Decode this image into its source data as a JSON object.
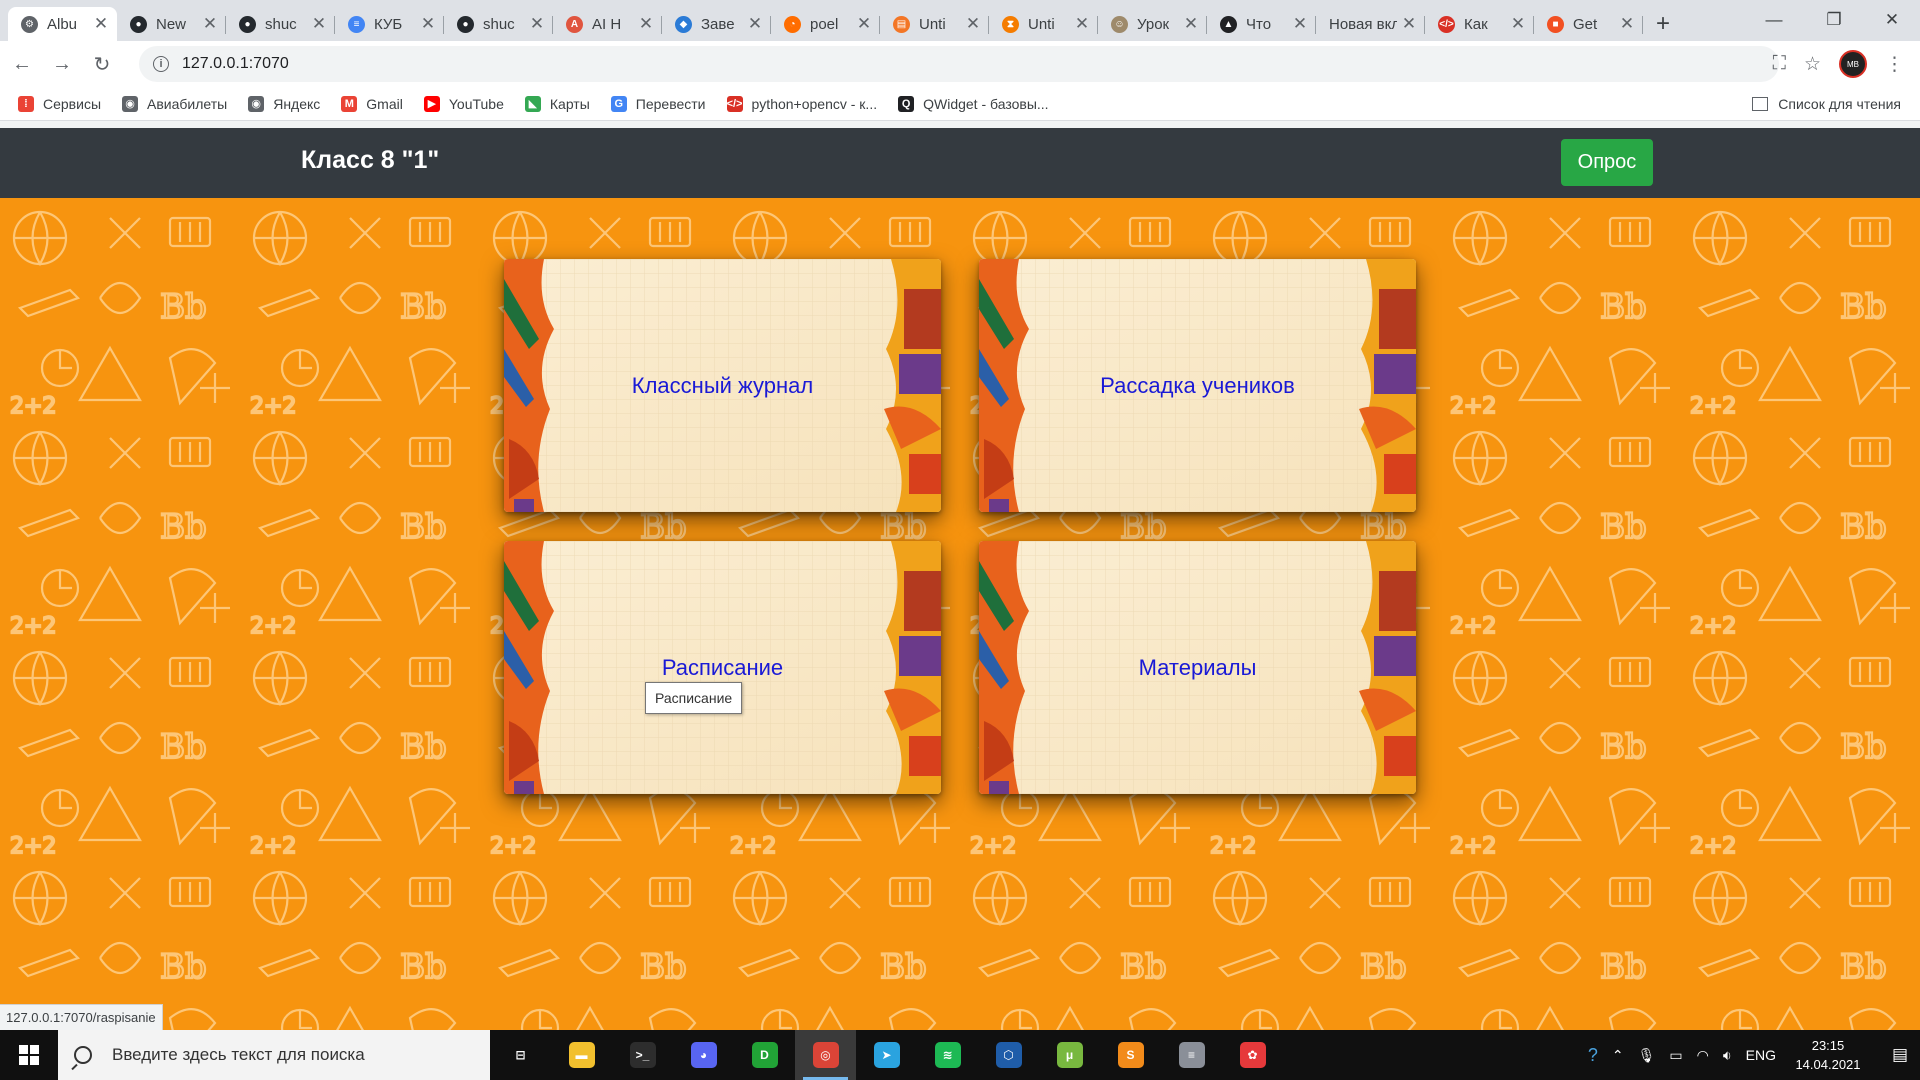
{
  "browser": {
    "tabs": [
      {
        "label": "Albu",
        "icon": "chrome-tab-icon",
        "color": "#5f6368",
        "glyph": "⚙",
        "active": true
      },
      {
        "label": "New",
        "icon": "github-icon",
        "color": "#24292e",
        "glyph": "●"
      },
      {
        "label": "shuc",
        "icon": "github-icon",
        "color": "#24292e",
        "glyph": "●"
      },
      {
        "label": "КУБ",
        "icon": "docs-icon",
        "color": "#4285f4",
        "glyph": "≡"
      },
      {
        "label": "shuc",
        "icon": "github-icon",
        "color": "#24292e",
        "glyph": "●"
      },
      {
        "label": "AI H",
        "icon": "ai-icon",
        "color": "#e0553f",
        "glyph": "A"
      },
      {
        "label": "Заве",
        "icon": "game-icon",
        "color": "#2b7bd6",
        "glyph": "◆"
      },
      {
        "label": "poel",
        "icon": "loading-icon",
        "color": "#ff6d00",
        "glyph": "◔"
      },
      {
        "label": "Unti",
        "icon": "notebook-icon",
        "color": "#f37626",
        "glyph": "▤"
      },
      {
        "label": "Unti",
        "icon": "hourglass-icon",
        "color": "#f57c00",
        "glyph": "⧗"
      },
      {
        "label": "Урок",
        "icon": "avatar-icon",
        "color": "#9e8a6b",
        "glyph": "☺"
      },
      {
        "label": "Что",
        "icon": "triangle-icon",
        "color": "#202124",
        "glyph": "▲"
      },
      {
        "label": "Новая вкл",
        "icon": "",
        "color": "",
        "glyph": ""
      },
      {
        "label": "Как",
        "icon": "code-icon",
        "color": "#d93025",
        "glyph": "</>"
      },
      {
        "label": "Get",
        "icon": "windows-logo-icon",
        "color": "#f25022",
        "glyph": "■"
      }
    ],
    "url": "127.0.0.1:7070",
    "bookmarks": [
      {
        "label": "Сервисы",
        "icon": "apps-grid-icon",
        "color": "#ea4335",
        "glyph": "⁞"
      },
      {
        "label": "Авиабилеты",
        "icon": "globe-icon",
        "color": "#5f6368",
        "glyph": "◉"
      },
      {
        "label": "Яндекс",
        "icon": "globe-icon",
        "color": "#5f6368",
        "glyph": "◉"
      },
      {
        "label": "Gmail",
        "icon": "gmail-icon",
        "color": "#ea4335",
        "glyph": "M"
      },
      {
        "label": "YouTube",
        "icon": "youtube-icon",
        "color": "#ff0000",
        "glyph": "▶"
      },
      {
        "label": "Карты",
        "icon": "maps-icon",
        "color": "#34a853",
        "glyph": "◣"
      },
      {
        "label": "Перевести",
        "icon": "translate-icon",
        "color": "#4285f4",
        "glyph": "G"
      },
      {
        "label": "python+opencv - к...",
        "icon": "code-icon",
        "color": "#d93025",
        "glyph": "</>"
      },
      {
        "label": "QWidget - базовы...",
        "icon": "qt-icon",
        "color": "#202124",
        "glyph": "Q"
      }
    ],
    "reading_list": "Список для чтения",
    "status_url": "127.0.0.1:7070/raspisanie"
  },
  "page": {
    "brand": "Класс 8 \"1\"",
    "survey_button": "Опрос",
    "cards": [
      {
        "label": "Классный журнал"
      },
      {
        "label": "Рассадка учеников"
      },
      {
        "label": "Расписание"
      },
      {
        "label": "Материалы"
      }
    ],
    "tooltip": "Расписание",
    "colors": {
      "navbar": "#343a40",
      "background": "#f7940f",
      "button": "#28a745",
      "card_text": "#1a1ad6"
    }
  },
  "taskbar": {
    "search_placeholder": "Введите здесь текст для поиска",
    "apps": [
      {
        "name": "task-view-icon",
        "color": "#101010",
        "glyph": "⊟"
      },
      {
        "name": "file-explorer-icon",
        "color": "#f2c02e",
        "glyph": "▬"
      },
      {
        "name": "terminal-icon",
        "color": "#2d2d2d",
        "glyph": ">_"
      },
      {
        "name": "discord-icon",
        "color": "#5865f2",
        "glyph": "◕"
      },
      {
        "name": "app-d-icon",
        "color": "#21a336",
        "glyph": "D"
      },
      {
        "name": "chrome-icon",
        "color": "#db4437",
        "glyph": "◎",
        "active": true
      },
      {
        "name": "telegram-icon",
        "color": "#2aa3df",
        "glyph": "➤"
      },
      {
        "name": "spotify-icon",
        "color": "#1db954",
        "glyph": "≋"
      },
      {
        "name": "virtualbox-icon",
        "color": "#1f5da9",
        "glyph": "⬡"
      },
      {
        "name": "utorrent-icon",
        "color": "#78b83f",
        "glyph": "μ"
      },
      {
        "name": "sublime-icon",
        "color": "#f28b1a",
        "glyph": "S"
      },
      {
        "name": "database-icon",
        "color": "#8a8f98",
        "glyph": "≡"
      },
      {
        "name": "color-app-icon",
        "color": "#e6393b",
        "glyph": "✿"
      }
    ],
    "language": "ENG",
    "time": "23:15",
    "date": "14.04.2021"
  }
}
